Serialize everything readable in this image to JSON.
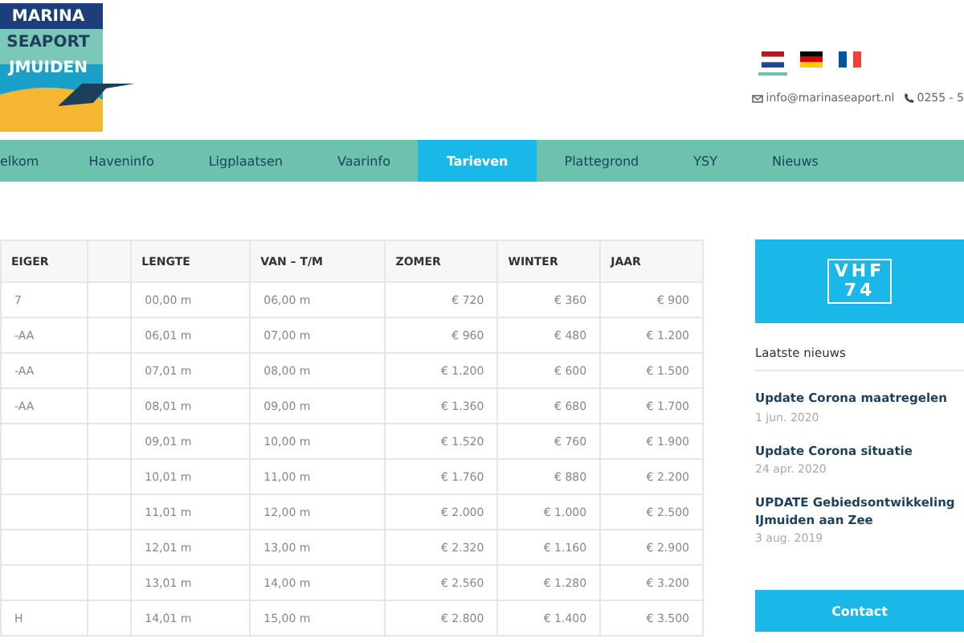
{
  "logo": {
    "lines": [
      "MARINA",
      "SEAPORT",
      "JMUIDEN"
    ]
  },
  "languages": [
    {
      "kind": "nl",
      "selected": true
    },
    {
      "kind": "de",
      "selected": false
    },
    {
      "kind": "fr",
      "selected": false
    }
  ],
  "contact": {
    "email": "info@marinaseaport.nl",
    "phone": "0255 - 5"
  },
  "nav": [
    {
      "label": "elkom",
      "selected": false
    },
    {
      "label": "Haveninfo",
      "selected": false
    },
    {
      "label": "Ligplaatsen",
      "selected": false
    },
    {
      "label": "Vaarinfo",
      "selected": false
    },
    {
      "label": "Tarieven",
      "selected": true
    },
    {
      "label": "Plattegrond",
      "selected": false
    },
    {
      "label": "YSY",
      "selected": false
    },
    {
      "label": "Nieuws",
      "selected": false
    }
  ],
  "table": {
    "columns": [
      "EIGER",
      "",
      "LENGTE",
      "VAN – T/M",
      "ZOMER",
      "WINTER",
      "JAAR"
    ],
    "rows": [
      [
        "7",
        "",
        "00,00 m",
        "06,00 m",
        "€ 720",
        "€ 360",
        "€ 900"
      ],
      [
        "-AA",
        "",
        "06,01 m",
        "07,00 m",
        "€ 960",
        "€ 480",
        "€ 1.200"
      ],
      [
        "-AA",
        "",
        "07,01 m",
        "08,00 m",
        "€ 1.200",
        "€ 600",
        "€ 1.500"
      ],
      [
        "-AA",
        "",
        "08,01 m",
        "09,00 m",
        "€ 1.360",
        "€ 680",
        "€ 1.700"
      ],
      [
        "",
        "",
        "09,01 m",
        "10,00 m",
        "€ 1.520",
        "€ 760",
        "€ 1.900"
      ],
      [
        "",
        "",
        "10,01 m",
        "11,00 m",
        "€ 1.760",
        "€ 880",
        "€ 2.200"
      ],
      [
        "",
        "",
        "11,01 m",
        "12,00 m",
        "€ 2.000",
        "€ 1.000",
        "€ 2.500"
      ],
      [
        "",
        "",
        "12,01 m",
        "13,00 m",
        "€ 2.320",
        "€ 1.160",
        "€ 2.900"
      ],
      [
        "",
        "",
        "13,01 m",
        "14,00 m",
        "€ 2.560",
        "€ 1.280",
        "€ 3.200"
      ],
      [
        "H",
        "",
        "14,01 m",
        "15,00 m",
        "€ 2.800",
        "€ 1.400",
        "€ 3.500"
      ]
    ]
  },
  "sidebar": {
    "vhf": [
      "VHF",
      "74"
    ],
    "news_heading": "Laatste nieuws",
    "news": [
      {
        "title": "Update Corona maatregelen",
        "date": "1 jun. 2020"
      },
      {
        "title": "Update Corona situatie",
        "date": "24 apr. 2020"
      },
      {
        "title": "UPDATE Gebiedsontwikkeling IJmuiden aan Zee",
        "date": "3 aug. 2019"
      }
    ],
    "buttons": [
      "Contact"
    ]
  }
}
